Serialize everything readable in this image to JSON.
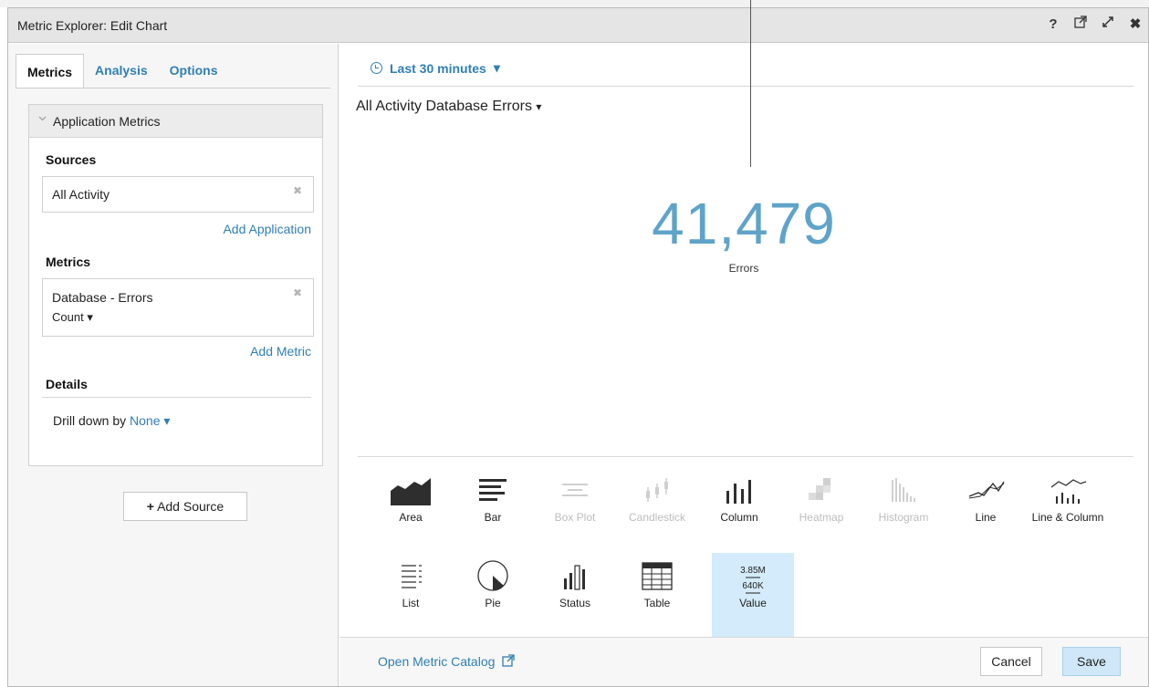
{
  "window": {
    "title": "Metric Explorer: Edit Chart",
    "icons": [
      "help-icon",
      "popout-icon",
      "expand-icon",
      "close-icon"
    ],
    "help_glyph": "?",
    "close_glyph": "✖"
  },
  "left": {
    "tabs": [
      {
        "label": "Metrics",
        "active": true
      },
      {
        "label": "Analysis",
        "active": false
      },
      {
        "label": "Options",
        "active": false
      }
    ],
    "panel_title": "Application Metrics",
    "sources_label": "Sources",
    "source_value": "All Activity",
    "add_application": "Add Application",
    "metrics_label": "Metrics",
    "metric_value": "Database - Errors",
    "aggregation": "Count",
    "add_metric": "Add Metric",
    "details_label": "Details",
    "drill_label": "Drill down by",
    "drill_value": "None",
    "add_source": "Add Source"
  },
  "right": {
    "time_range": "Last 30 minutes",
    "chart_title": "All Activity Database Errors",
    "value": "41,479",
    "unit": "Errors",
    "chart_types": [
      {
        "label": "Area",
        "icon": "area-chart-icon",
        "enabled": true
      },
      {
        "label": "Bar",
        "icon": "bar-chart-icon",
        "enabled": true
      },
      {
        "label": "Box Plot",
        "icon": "box-plot-icon",
        "enabled": false
      },
      {
        "label": "Candlestick",
        "icon": "candlestick-icon",
        "enabled": false
      },
      {
        "label": "Column",
        "icon": "column-chart-icon",
        "enabled": true
      },
      {
        "label": "Heatmap",
        "icon": "heatmap-icon",
        "enabled": false
      },
      {
        "label": "Histogram",
        "icon": "histogram-icon",
        "enabled": false
      },
      {
        "label": "Line",
        "icon": "line-chart-icon",
        "enabled": true
      },
      {
        "label": "Line & Column",
        "icon": "line-column-icon",
        "enabled": true
      },
      {
        "label": "List",
        "icon": "list-icon",
        "enabled": true
      },
      {
        "label": "Pie",
        "icon": "pie-chart-icon",
        "enabled": true
      },
      {
        "label": "Status",
        "icon": "status-icon",
        "enabled": true
      },
      {
        "label": "Table",
        "icon": "table-icon",
        "enabled": true
      },
      {
        "label": "Value",
        "icon": "value-icon",
        "enabled": true,
        "selected": true
      }
    ],
    "value_icon_top": "3.85M",
    "value_icon_bottom": "640K",
    "catalog_link": "Open Metric Catalog",
    "cancel": "Cancel",
    "save": "Save"
  },
  "colors": {
    "accent": "#2f7fb5",
    "value": "#5fa3c9",
    "selected": "#d3ebfa"
  }
}
